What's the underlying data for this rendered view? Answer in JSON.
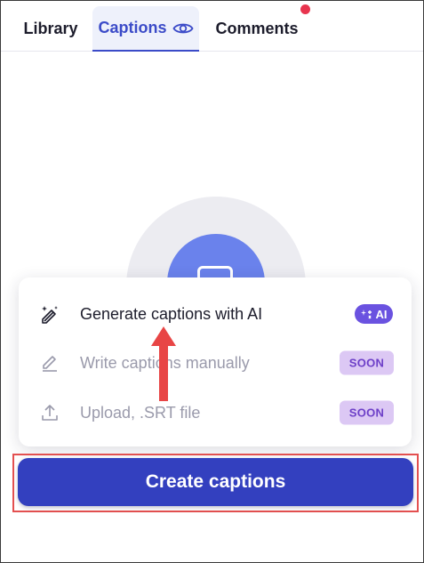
{
  "tabs": [
    {
      "label": "Library",
      "active": false
    },
    {
      "label": "Captions",
      "active": true,
      "icon": "eye-icon"
    },
    {
      "label": "Comments",
      "active": false,
      "has_notification": true
    }
  ],
  "menu": {
    "items": [
      {
        "label": "Generate captions with AI",
        "icon": "sparkle-pen-icon",
        "badge": "AI",
        "badge_icon": "sparkle-icon",
        "enabled": true
      },
      {
        "label": "Write captions manually",
        "icon": "pencil-icon",
        "badge": "SOON",
        "enabled": false
      },
      {
        "label": "Upload, .SRT file",
        "icon": "upload-icon",
        "badge": "SOON",
        "enabled": false
      }
    ]
  },
  "create_button": {
    "label": "Create captions"
  },
  "colors": {
    "accent": "#3b4bc8",
    "button": "#3340bf",
    "ai_badge": "#6a52e0",
    "soon_badge_bg": "#dcc8f4",
    "soon_badge_text": "#6d3fc8",
    "annotation": "#e35050",
    "notification": "#e8344e"
  }
}
